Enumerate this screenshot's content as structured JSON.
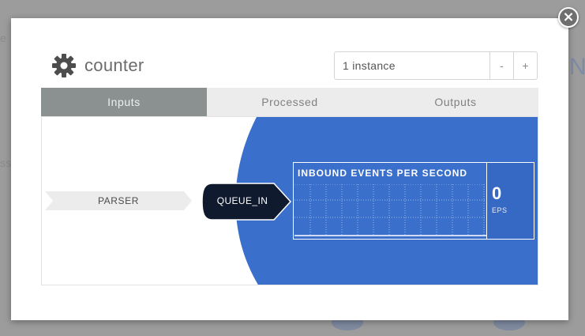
{
  "dialog": {
    "title": "counter",
    "close_label": "×"
  },
  "instances": {
    "value": "1 instance",
    "decrement_label": "-",
    "increment_label": "+"
  },
  "tabs": [
    {
      "label": "Inputs",
      "active": true
    },
    {
      "label": "Processed",
      "active": false
    },
    {
      "label": "Outputs",
      "active": false
    }
  ],
  "flow": {
    "source_label": "PARSER",
    "queue_label": "QUEUE_IN"
  },
  "metric": {
    "title": "INBOUND EVENTS PER SECOND",
    "value": "0",
    "unit": "EPS"
  },
  "colors": {
    "accent_blue": "#3a6fcc",
    "queue_navy": "#0f1a2e",
    "active_tab": "#8b9091"
  },
  "icons": {
    "title": "gear-icon",
    "close": "close-icon"
  },
  "background": {
    "fragment_top": "e",
    "fragment_mid": "sse",
    "fragment_right": "N"
  }
}
